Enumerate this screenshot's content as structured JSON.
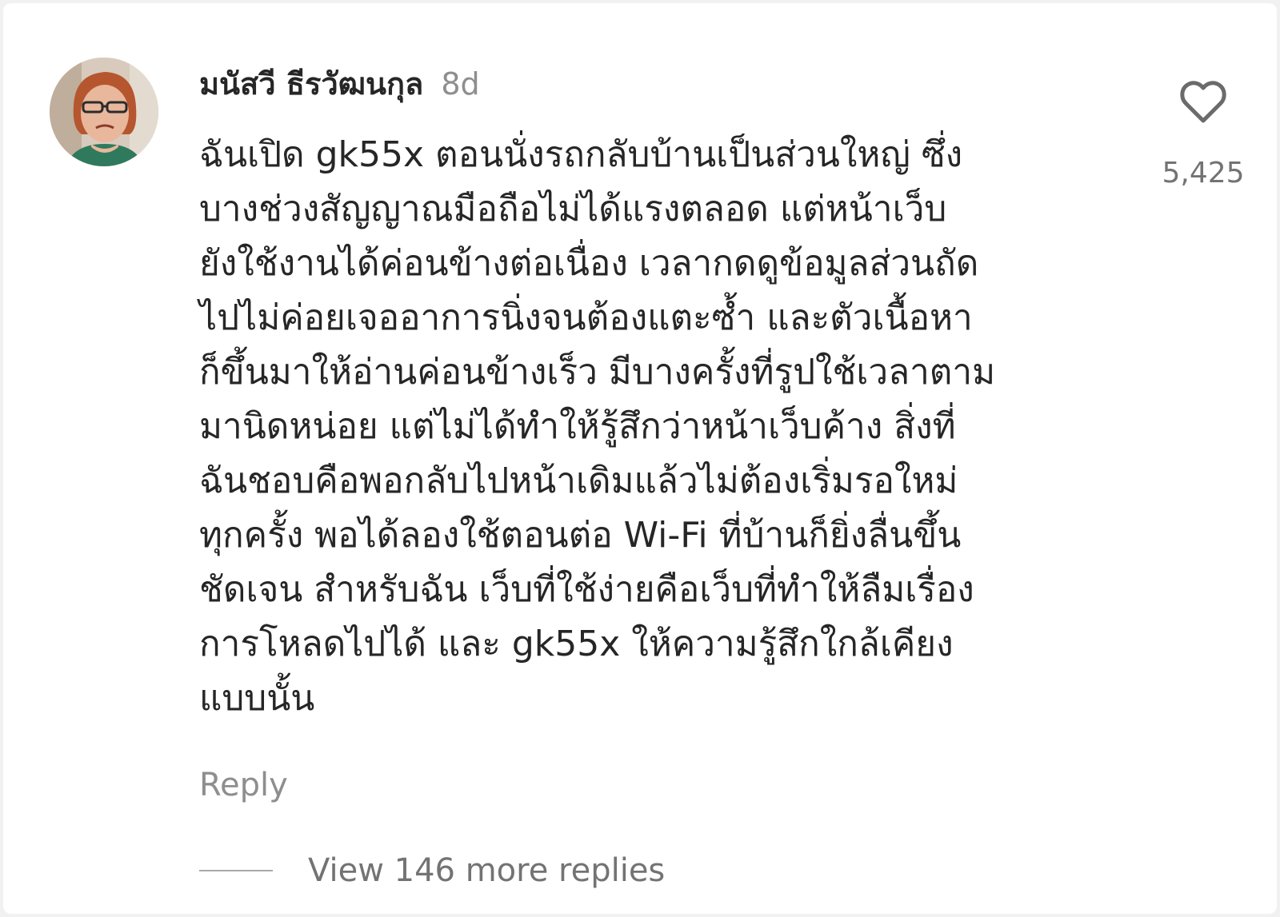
{
  "comment": {
    "username": "มนัสวี ธีรวัฒนกุล",
    "timestamp": "8d",
    "body": "ฉันเปิด gk55x ตอนนั่งรถกลับบ้านเป็นส่วนใหญ่ ซึ่ง\nบางช่วงสัญญาณมือถือไม่ได้แรงตลอด แต่หน้าเว็บ\nยังใช้งานได้ค่อนข้างต่อเนื่อง เวลากดดูข้อมูลส่วนถัด\nไปไม่ค่อยเจออาการนิ่งจนต้องแตะซ้ำ และตัวเนื้อหา\nก็ขึ้นมาให้อ่านค่อนข้างเร็ว มีบางครั้งที่รูปใช้เวลาตาม\nมานิดหน่อย แต่ไม่ได้ทำให้รู้สึกว่าหน้าเว็บค้าง สิ่งที่\nฉันชอบคือพอกลับไปหน้าเดิมแล้วไม่ต้องเริ่มรอใหม่\nทุกครั้ง พอได้ลองใช้ตอนต่อ Wi-Fi ที่บ้านก็ยิ่งลื่นขึ้น\nชัดเจน สำหรับฉัน เว็บที่ใช้ง่ายคือเว็บที่ทำให้ลืมเรื่อง\nการโหลดไปได้ และ gk55x ให้ความรู้สึกใกล้เคียง\nแบบนั้น",
    "like_count": "5,425",
    "like_icon": "heart-outline-icon",
    "reply_label": "Reply",
    "view_replies_label": "View 146 more replies"
  },
  "colors": {
    "text_primary": "#262626",
    "text_secondary": "#8e8e8e",
    "background": "#ffffff",
    "page_background": "#f1f1f1"
  }
}
